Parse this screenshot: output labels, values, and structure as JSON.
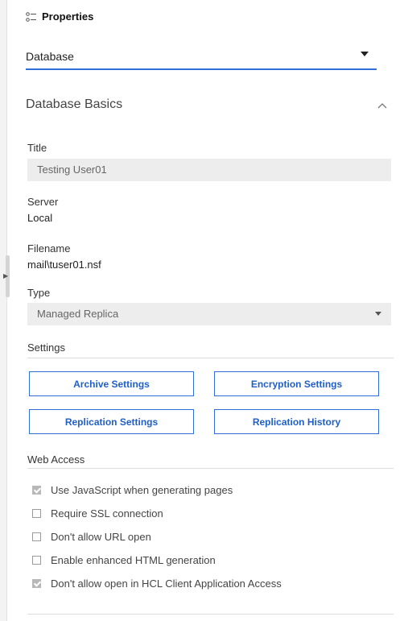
{
  "header": {
    "title": "Properties",
    "icon": "properties-icon"
  },
  "database_dropdown": {
    "value": "Database"
  },
  "section": {
    "title": "Database Basics"
  },
  "fields": {
    "title_label": "Title",
    "title_value": "Testing User01",
    "server_label": "Server",
    "server_value": "Local",
    "filename_label": "Filename",
    "filename_value": "mail\\tuser01.nsf",
    "type_label": "Type",
    "type_value": "Managed Replica"
  },
  "settings": {
    "heading": "Settings",
    "buttons": [
      "Archive Settings",
      "Encryption Settings",
      "Replication Settings",
      "Replication History"
    ]
  },
  "web_access": {
    "heading": "Web Access",
    "options": [
      {
        "label": "Use JavaScript when generating pages",
        "checked": true
      },
      {
        "label": "Require SSL connection",
        "checked": false
      },
      {
        "label": "Don't allow URL open",
        "checked": false
      },
      {
        "label": "Enable enhanced HTML generation",
        "checked": false
      },
      {
        "label": "Don't allow open in HCL Client Application Access",
        "checked": true
      }
    ]
  },
  "colors": {
    "accent": "#2f6fd6",
    "field_bg": "#ededed"
  }
}
